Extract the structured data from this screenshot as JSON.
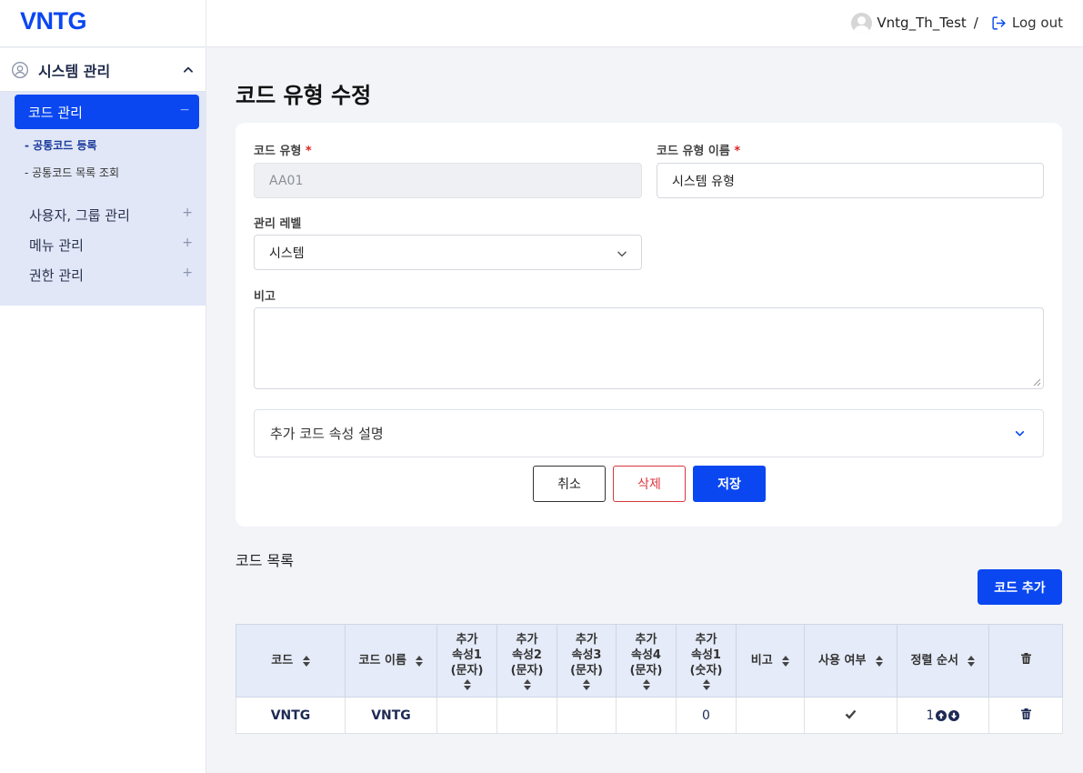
{
  "header": {
    "logo": "VNTG",
    "user_name": "Vntg_Th_Test",
    "separator": "/",
    "logout_label": "Log out"
  },
  "sidebar": {
    "group_label": "시스템 관리",
    "active_item": "코드 관리",
    "active_item_toggle": "−",
    "sub_items": [
      {
        "label": "- 공통코드 등록",
        "active": true
      },
      {
        "label": "- 공통코드 목록 조회",
        "active": false
      }
    ],
    "items": [
      {
        "label": "사용자, 그룹 관리",
        "toggle": "+"
      },
      {
        "label": "메뉴 관리",
        "toggle": "+"
      },
      {
        "label": "권한 관리",
        "toggle": "+"
      }
    ]
  },
  "page": {
    "title": "코드 유형 수정"
  },
  "form": {
    "code_type_label": "코드 유형",
    "code_type_value": "AA01",
    "code_type_name_label": "코드 유형 이름",
    "code_type_name_value": "시스템 유형",
    "required_mark": "*",
    "level_label": "관리 레벨",
    "level_value": "시스템",
    "note_label": "비고",
    "note_value": "",
    "accordion_label": "추가 코드 속성 설명",
    "cancel_label": "취소",
    "delete_label": "삭제",
    "save_label": "저장"
  },
  "code_list": {
    "title": "코드 목록",
    "add_label": "코드 추가",
    "columns": [
      [
        "코드"
      ],
      [
        "코드 이름"
      ],
      [
        "추가",
        "속성1",
        "(문자)"
      ],
      [
        "추가",
        "속성2",
        "(문자)"
      ],
      [
        "추가",
        "속성3",
        "(문자)"
      ],
      [
        "추가",
        "속성4",
        "(문자)"
      ],
      [
        "추가",
        "속성1",
        "(숫자)"
      ],
      [
        "비고"
      ],
      [
        "사용 여부"
      ],
      [
        "정렬 순서"
      ]
    ],
    "rows": [
      {
        "code": "VNTG",
        "name": "VNTG",
        "attr1": "",
        "attr2": "",
        "attr3": "",
        "attr4": "",
        "num1": "0",
        "note": "",
        "used": true,
        "order": "1"
      }
    ]
  },
  "colors": {
    "primary": "#0a47f0",
    "danger": "#d9363e",
    "sidebar_bg": "#e1e7f7",
    "table_header_bg": "#e5ebf8"
  }
}
